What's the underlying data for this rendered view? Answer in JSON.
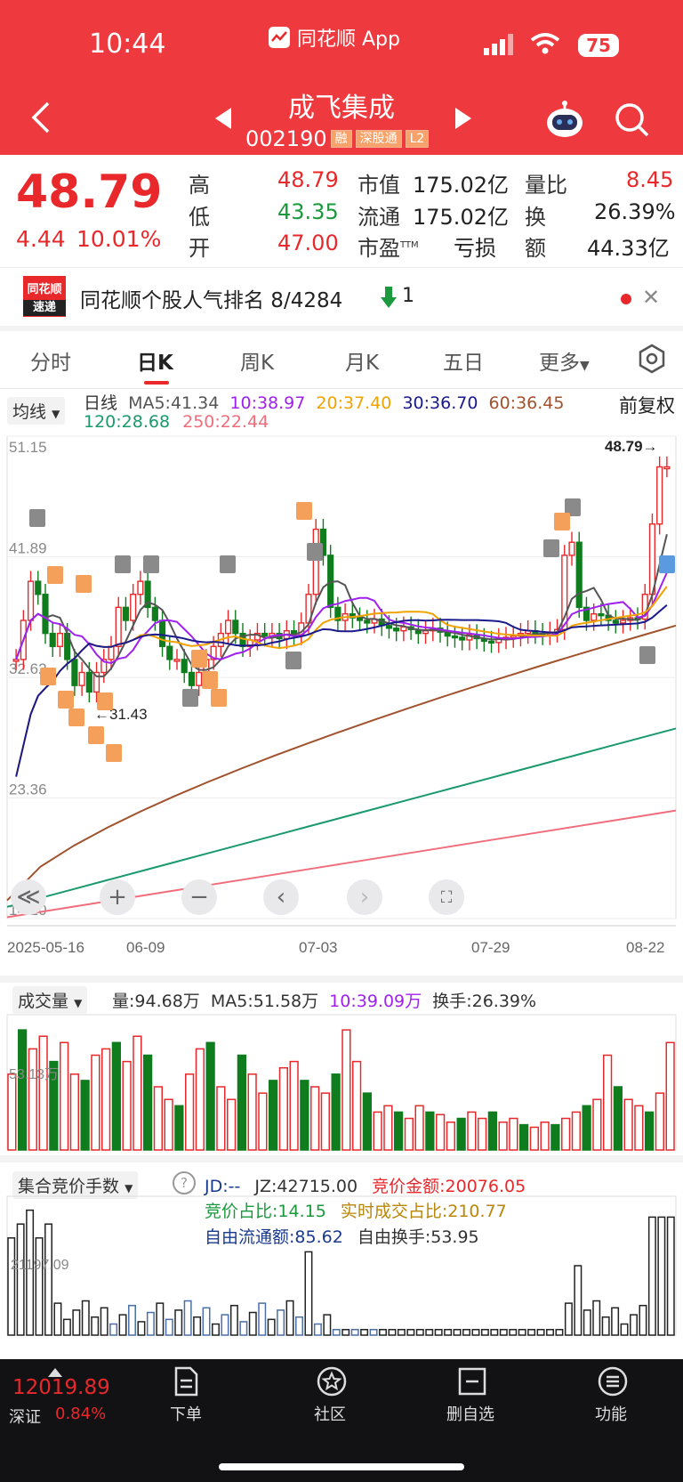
{
  "status_bar": {
    "time": "10:44",
    "app_name": "同花顺 App",
    "battery": "75"
  },
  "header": {
    "stock_name": "成飞集成",
    "stock_code": "002190",
    "badges": [
      "融",
      "深股通",
      "L2"
    ]
  },
  "quote": {
    "price": "48.79",
    "change": "4.44",
    "change_pct": "10.01%",
    "high_label": "高",
    "high": "48.79",
    "low_label": "低",
    "low": "43.35",
    "open_label": "开",
    "open": "47.00",
    "mktcap_label": "市值",
    "mktcap": "175.02亿",
    "float_label": "流通",
    "float": "175.02亿",
    "pe_label": "市盈",
    "pe_sup": "TTM",
    "pe": "亏损",
    "volratio_label": "量比",
    "volratio": "8.45",
    "turnover_label": "换",
    "turnover": "26.39%",
    "amount_label": "额",
    "amount": "44.33亿"
  },
  "banner": {
    "logo_top": "同花顺",
    "logo_bottom": "速递",
    "text": "同花顺个股人气排名 8/4284",
    "rank_change": "1"
  },
  "tabs": [
    "分时",
    "日K",
    "周K",
    "月K",
    "五日",
    "更多"
  ],
  "ma_bar": {
    "selector": "均线",
    "label": "日线",
    "adjust": "前复权",
    "ma5": "MA5:41.34",
    "ma10": "10:38.97",
    "ma20": "20:37.40",
    "ma30": "30:36.70",
    "ma60": "60:36.45",
    "ma120": "120:28.68",
    "ma250": "250:22.44"
  },
  "chart_data": [
    {
      "type": "candlestick",
      "title": "",
      "y_ticks": [
        "51.15",
        "41.89",
        "32.62",
        "23.36",
        "14.10"
      ],
      "ylim": [
        14.1,
        51.15
      ],
      "x_ticks": [
        "2025-05-16",
        "06-09",
        "07-03",
        "07-29",
        "08-22"
      ],
      "last_price_label": "48.79→",
      "low_marker_label": "←31.43",
      "colors": {
        "up": "#e8282b",
        "down": "#0f7d1e",
        "ma5": "#555555",
        "ma10": "#a020f0",
        "ma20": "#f0a300",
        "ma30": "#1a1a8c",
        "ma60": "#a0522d",
        "ma120": "#1a9a6c",
        "ma250": "#f06e7c"
      }
    },
    {
      "type": "bar",
      "title": "成交量",
      "series_text": {
        "vol": "量:94.68万",
        "ma5": "MA5:51.58万",
        "ma10": "10:39.09万",
        "turnover": "换手:26.39%"
      },
      "y_tick": "53.13万"
    },
    {
      "type": "bar",
      "title": "集合竞价手数",
      "y_tick": "21197.09",
      "stats": {
        "jd": "JD:--",
        "jz": "JZ:42715.00",
        "bid_amount": "竞价金额:20076.05",
        "bid_ratio": "竞价占比:14.15",
        "rt_ratio": "实时成交占比:210.77",
        "free_float": "自由流通额:85.62",
        "free_turnover": "自由换手:53.95"
      }
    }
  ],
  "bottom": {
    "index_value": "12019.89",
    "index_name": "深证",
    "index_change": "0.84%",
    "nav": [
      "下单",
      "社区",
      "删自选",
      "功能"
    ]
  }
}
